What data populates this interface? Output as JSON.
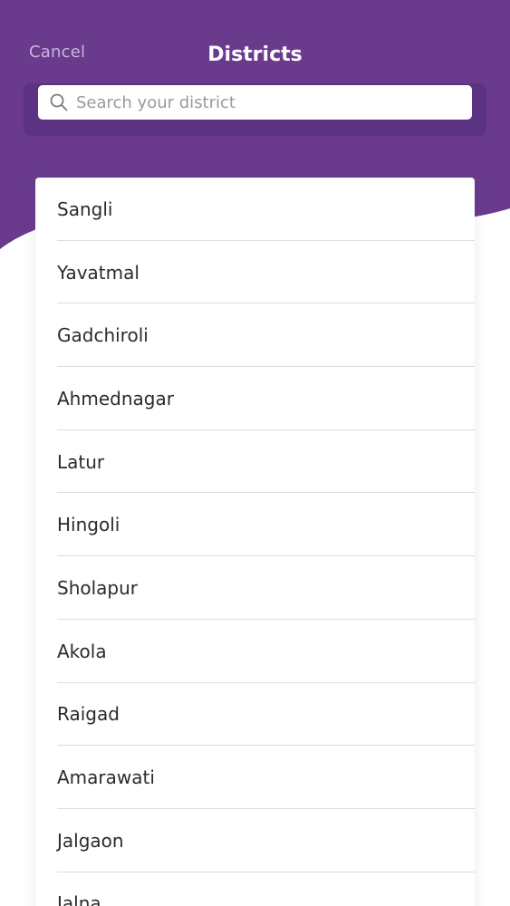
{
  "header": {
    "cancel_label": "Cancel",
    "title": "Districts"
  },
  "search": {
    "placeholder": "Search your district"
  },
  "districts": [
    "Sangli",
    "Yavatmal",
    "Gadchiroli",
    "Ahmednagar",
    "Latur",
    "Hingoli",
    "Sholapur",
    "Akola",
    "Raigad",
    "Amarawati",
    "Jalgaon",
    "Jalna"
  ],
  "colors": {
    "brand_purple": "#6a3a8c",
    "search_panel": "#5c3282",
    "cancel_text": "#c8b6dc"
  },
  "icons": {
    "search": "search-icon"
  }
}
